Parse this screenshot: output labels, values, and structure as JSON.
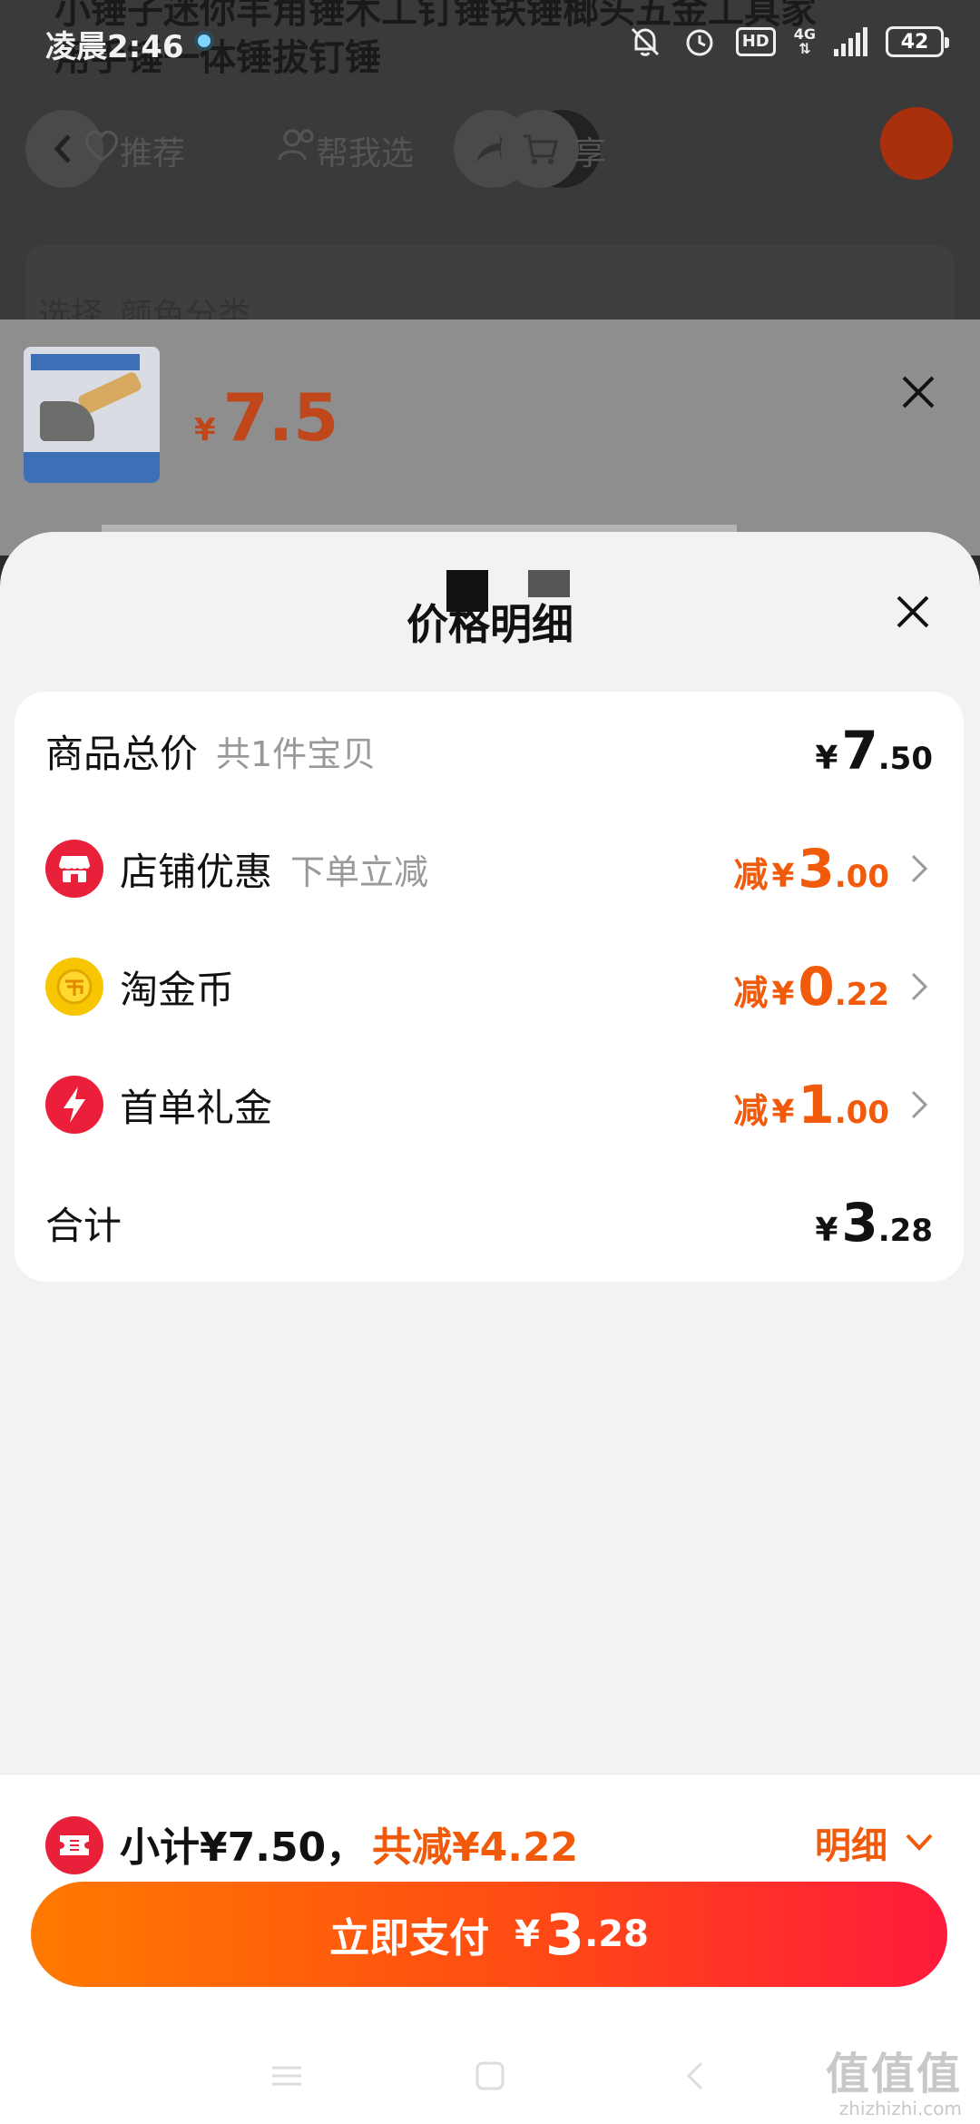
{
  "status_bar": {
    "time": "凌晨2:46",
    "network": "4G",
    "battery": "42",
    "hd_label": "HD"
  },
  "background_page": {
    "title_line1": "小锤子迷你羊角锤木工钉锤铁锤榔头五金工具家",
    "title_line2": "用手锤一体锤拔钉锤",
    "nav_recommend": "推荐",
    "nav_help_choose": "帮我选",
    "nav_share": "享",
    "select_label": "选择",
    "color_label": "颜色分类"
  },
  "sku_panel": {
    "currency": "¥",
    "price": "7.5"
  },
  "sheet": {
    "title": "价格明细"
  },
  "price_rows": {
    "total": {
      "label": "商品总价",
      "sub": "共1件宝贝",
      "currency": "¥",
      "int": "7",
      "dec": ".50"
    },
    "shop_discount": {
      "label": "店铺优惠",
      "sub": "下单立减",
      "prefix": "减",
      "currency": "¥",
      "int": "3",
      "dec": ".00"
    },
    "coins": {
      "label": "淘金币",
      "prefix": "减",
      "currency": "¥",
      "int": "0",
      "dec": ".22"
    },
    "first_order": {
      "label": "首单礼金",
      "prefix": "减",
      "currency": "¥",
      "int": "1",
      "dec": ".00"
    },
    "sum": {
      "label": "合计",
      "currency": "¥",
      "int": "3",
      "dec": ".28"
    }
  },
  "bottom_bar": {
    "subtotal_text": "小计¥7.50，",
    "discount_text": "共减¥4.22",
    "detail_label": "明细",
    "pay_label": "立即支付",
    "pay_currency": "¥",
    "pay_int": "3",
    "pay_dec": ".28"
  },
  "watermark": {
    "big": "值值值",
    "small": "zhizhizhi.com"
  },
  "colors": {
    "accent_orange": "#f05a0a",
    "pay_gradient_start": "#ff7a00",
    "pay_gradient_end": "#ff1a3c",
    "shop_icon_red": "#e8203a",
    "coin_yellow": "#f7c600"
  }
}
